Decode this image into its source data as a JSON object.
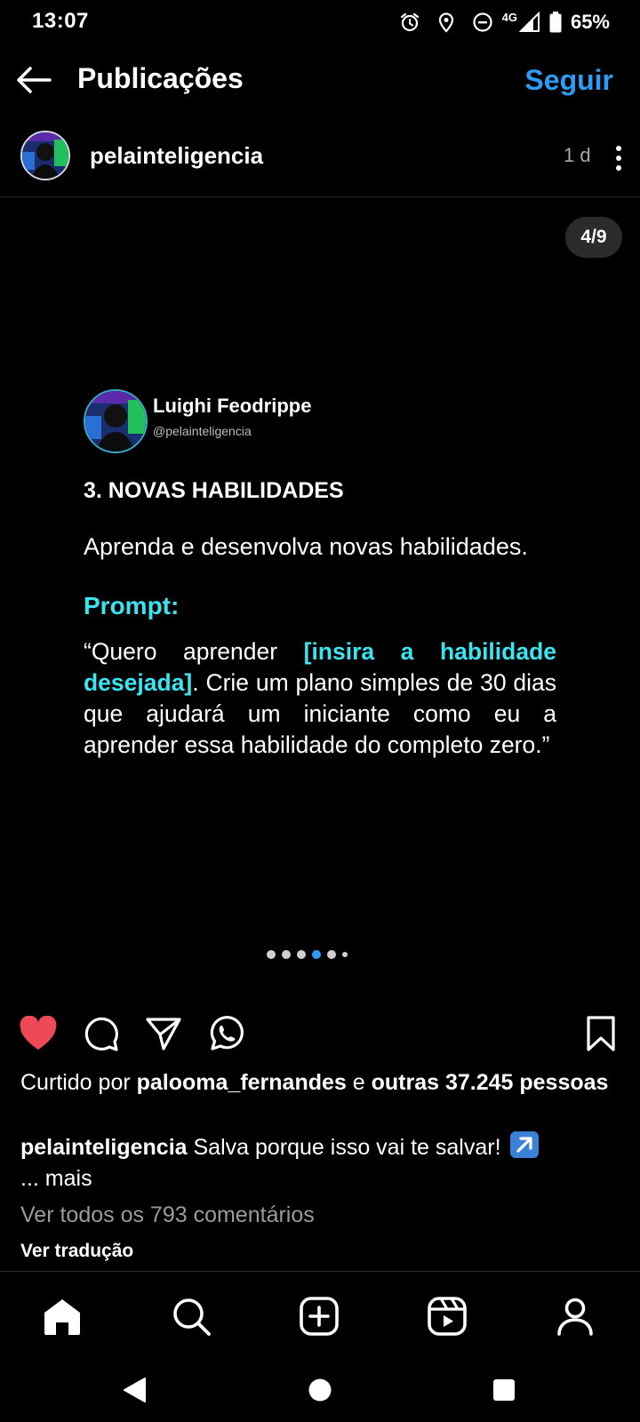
{
  "status_bar": {
    "time": "13:07",
    "network": "4G",
    "battery": "65%",
    "icons": [
      "alarm-icon",
      "location-icon",
      "do-not-disturb-icon",
      "signal-icon",
      "battery-icon"
    ]
  },
  "header": {
    "title": "Publicações",
    "follow_label": "Seguir",
    "back_icon": "arrow-left-icon"
  },
  "post": {
    "author": "pelainteligencia",
    "time_ago": "1 d",
    "slide_counter": "4/9",
    "slide_index": 4,
    "dots_visible": 6,
    "card": {
      "name": "Luighi Feodrippe",
      "handle": "@pelainteligencia",
      "heading": "3. NOVAS HABILIDADES",
      "subtitle": "Aprenda e desenvolva novas habilidades.",
      "prompt_label": "Prompt:",
      "quote_open": "“Quero aprender ",
      "quote_highlight": "[insira a habilidade desejada]",
      "quote_rest": ". Crie um plano simples de 30 dias que ajudará um iniciante como eu a aprender essa habilidade do completo zero.”"
    }
  },
  "actions": {
    "like_icon": "heart-filled-icon",
    "comment_icon": "comment-icon",
    "share_icon": "send-icon",
    "whatsapp_icon": "whatsapp-icon",
    "save_icon": "bookmark-icon",
    "like_color": "#ed4956"
  },
  "caption": {
    "liked_prefix": "Curtido por ",
    "liked_user": "paloома_fernandes",
    "liked_joiner": " e ",
    "liked_others": "outras 37.245 pessoas",
    "author": "pelainteligencia",
    "text": " Salva porque isso vai te salvar! ",
    "more": "... mais",
    "view_comments": "Ver todos os 793 comentários",
    "translate": "Ver tradução"
  },
  "bottom_nav": {
    "items": [
      "home-icon",
      "search-icon",
      "create-icon",
      "reels-icon",
      "profile-icon"
    ]
  },
  "colors": {
    "accent_blue": "#2d9cf4",
    "highlight_cyan": "#3ae4f0"
  }
}
